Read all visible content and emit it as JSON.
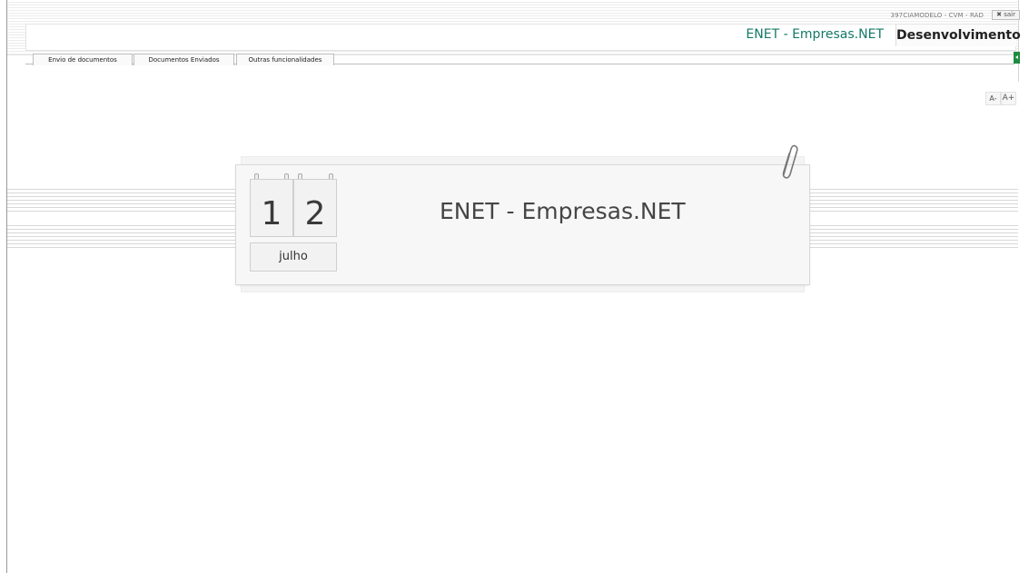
{
  "header": {
    "user_info": "397CIAMODELO - CVM - RAD",
    "logout_label": "✖ sair",
    "app_title": "ENET - Empresas.NET",
    "environment": "Desenvolvimento",
    "title_color": "#137a68"
  },
  "tabs": [
    {
      "label": "Envio de documentos"
    },
    {
      "label": "Documentos Enviados"
    },
    {
      "label": "Outras funcionalidades"
    }
  ],
  "font_controls": {
    "decrease": "A-",
    "increase": "A+"
  },
  "card": {
    "day_digit_1": "1",
    "day_digit_2": "2",
    "month": "julho",
    "title": "ENET - Empresas.NET",
    "icon": "paperclip-icon"
  },
  "colors": {
    "panel_toggle": "#1e8c3f"
  }
}
